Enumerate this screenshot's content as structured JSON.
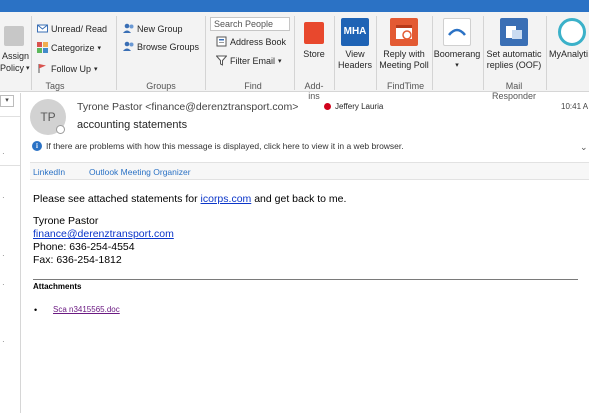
{
  "ribbon": {
    "respond_group": {
      "assign_label": "Assign",
      "policy_label": "Policy"
    },
    "tags_group": {
      "label": "Tags",
      "unread_read": "Unread/ Read",
      "categorize": "Categorize",
      "follow_up": "Follow Up"
    },
    "groups_group": {
      "label": "Groups",
      "new_group": "New Group",
      "browse_groups": "Browse Groups"
    },
    "find_group": {
      "label": "Find",
      "search_placeholder": "Search People",
      "address_book": "Address Book",
      "filter_email": "Filter Email"
    },
    "addins_group": {
      "label": "Add-ins",
      "store": "Store"
    },
    "mha": {
      "icon_text": "MHA",
      "label_line1": "View",
      "label_line2": "Headers"
    },
    "findtime_group": {
      "label": "FindTime",
      "reply_line1": "Reply with",
      "reply_line2": "Meeting Poll"
    },
    "boomerang": {
      "label": "Boomerang"
    },
    "mail_responder_group": {
      "label": "Mail Responder",
      "line1": "Set automatic",
      "line2": "replies (OOF)"
    },
    "myanalytics": {
      "label": "MyAnalyti"
    }
  },
  "left_pane": {
    "dropdown_glyph": "▾"
  },
  "message": {
    "avatar_initials": "TP",
    "sender": "Tyrone Pastor <finance@derenztransport.com>",
    "recipient": "Jeffery Lauria",
    "time": "10:41 A",
    "subject": "accounting statements",
    "info_text": "If there are problems with how this message is displayed, click here to view it in a web browser.",
    "tabs": [
      "LinkedIn",
      "Outlook Meeting Organizer"
    ]
  },
  "body": {
    "line1_prefix": "Please see attached statements for ",
    "line1_link": "icorps.com",
    "line1_suffix": " and get back to me.",
    "sig_name": "Tyrone Pastor",
    "sig_email": "finance@derenztransport.com",
    "sig_phone": "Phone: 636-254-4554",
    "sig_fax": "Fax: 636-254-1812",
    "attachments_title": "Attachments",
    "attachment_file": "Sca n3415565.doc"
  },
  "colors": {
    "accent": "#2b72c5",
    "link": "#0b36c9",
    "visited_link": "#6b1a82",
    "presence_red": "#d0021b"
  }
}
